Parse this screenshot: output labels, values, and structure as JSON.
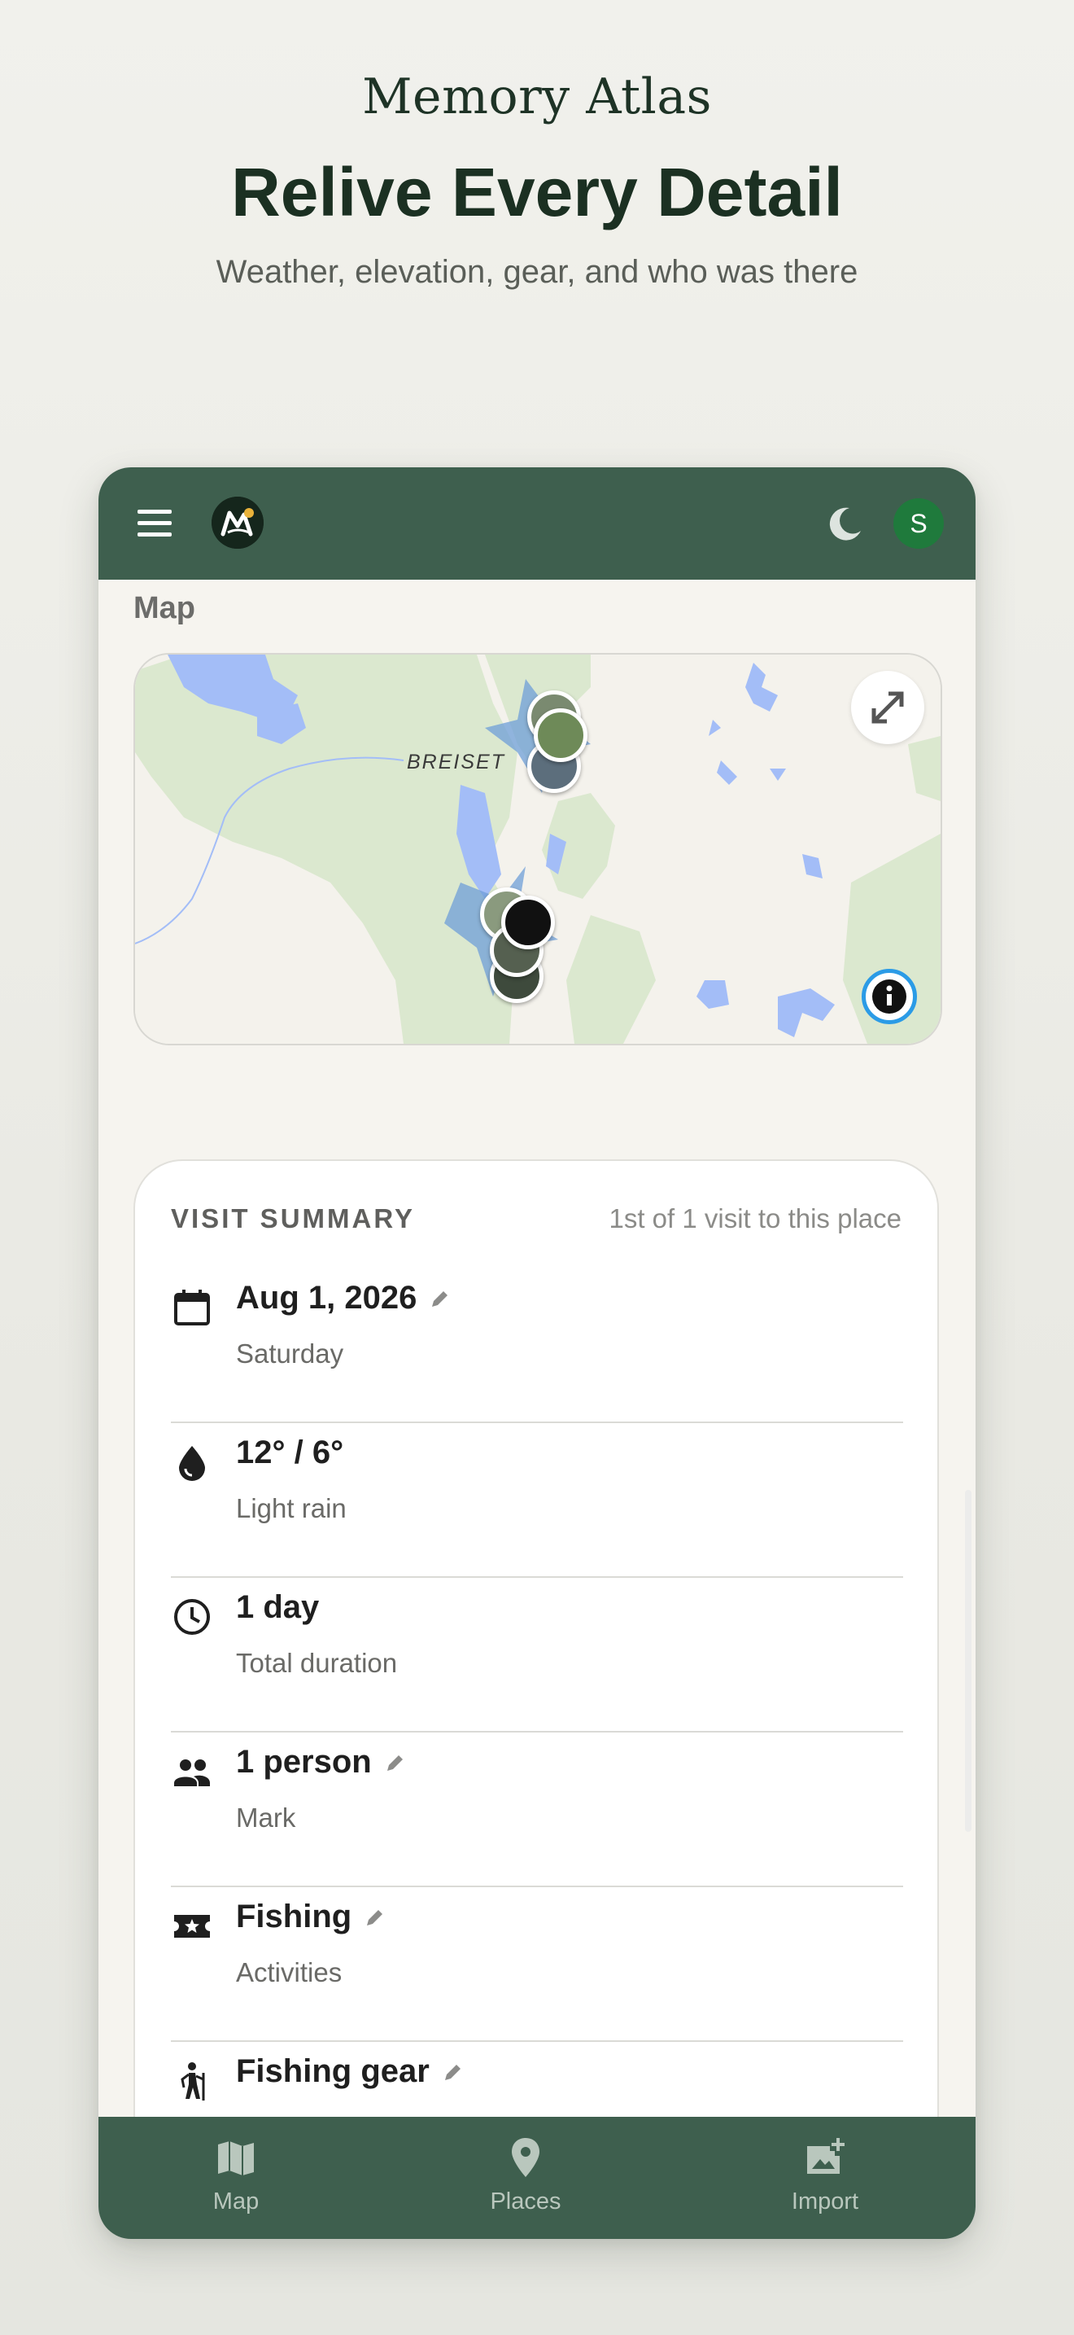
{
  "hero": {
    "brand": "Memory Atlas",
    "headline": "Relive Every Detail",
    "subhead": "Weather, elevation, gear, and who was there"
  },
  "topbar": {
    "menu_icon": "hamburger-menu-icon",
    "logo_icon": "memory-atlas-logo",
    "theme_icon": "dark-mode-moon-icon",
    "avatar_initial": "S",
    "avatar_color": "#1f7a3c",
    "bar_color": "#3e5f4e"
  },
  "map_section": {
    "label": "Map",
    "place_label": "BREISET",
    "expand_icon": "expand-arrows-icon",
    "info_icon": "info-icon"
  },
  "summary": {
    "title": "VISIT SUMMARY",
    "visit_count": "1st of 1 visit to this place",
    "rows": [
      {
        "icon": "calendar-icon",
        "main": "Aug 1, 2026",
        "sub": "Saturday",
        "editable": true
      },
      {
        "icon": "rain-drop-icon",
        "main": "12° / 6°",
        "sub": "Light rain",
        "editable": false
      },
      {
        "icon": "clock-icon",
        "main": "1 day",
        "sub": "Total duration",
        "editable": false
      },
      {
        "icon": "people-icon",
        "main": "1 person",
        "sub": "Mark",
        "editable": true
      },
      {
        "icon": "ticket-star-icon",
        "main": "Fishing",
        "sub": "Activities",
        "editable": true
      },
      {
        "icon": "hiker-icon",
        "main": "Fishing gear",
        "sub": "",
        "editable": true
      }
    ]
  },
  "bottom_nav": {
    "items": [
      {
        "icon": "map-icon",
        "label": "Map"
      },
      {
        "icon": "location-pin-icon",
        "label": "Places"
      },
      {
        "icon": "add-photo-icon",
        "label": "Import"
      }
    ]
  },
  "colors": {
    "accent_green": "#3e5f4e",
    "water_blue": "#a3bdf7",
    "land_green": "#dbe8cf",
    "info_ring_blue": "#2b9be6"
  }
}
